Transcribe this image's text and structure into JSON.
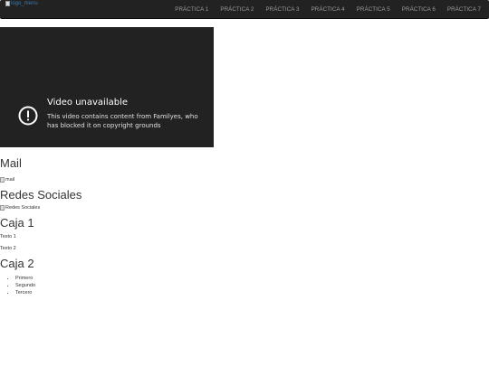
{
  "navbar": {
    "logo_alt": "logo_menu",
    "items": [
      "PRÁCTICA 1",
      "PRÁCTICA 2",
      "PRÁCTICA 3",
      "PRÁCTICA 4",
      "PRÁCTICA 5",
      "PRÁCTICA 6",
      "PRÁCTICA 7"
    ]
  },
  "video": {
    "title": "Video unavailable",
    "message": "This video contains content from Familyes, who has blocked it on copyright grounds",
    "icons": [
      "alert-icon",
      "youtube-icon"
    ]
  },
  "sections": {
    "mail": {
      "heading": "Mail",
      "img_alt": "mail"
    },
    "redes": {
      "heading": "Redes Sociales",
      "img_alt": "Redes Sociales"
    },
    "caja1": {
      "heading": "Caja 1",
      "texts": [
        "Texto 1",
        "Texto 2"
      ]
    },
    "caja2": {
      "heading": "Caja 2",
      "items": [
        "Primero",
        "Segundo",
        "Tercero"
      ]
    }
  },
  "colors": {
    "navbar_bg": "#222222",
    "nav_text": "#9d9d9d",
    "link": "#337ab7",
    "video_bg": "#222222"
  }
}
